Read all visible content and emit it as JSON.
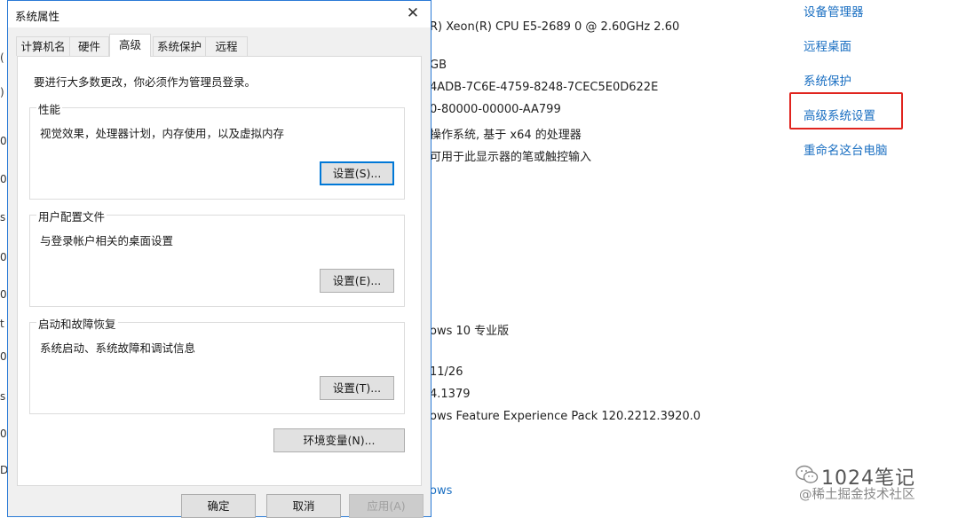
{
  "background": {
    "left_marks": [
      "(",
      ")",
      "0",
      "0",
      "s",
      "0",
      "0",
      "t",
      "0",
      "s",
      "0",
      "D"
    ],
    "info_lines": [
      "R) Xeon(R) CPU E5-2689 0 @ 2.60GHz   2.60",
      "GB",
      "4ADB-7C6E-4759-8248-7CEC5E0D622E",
      "0-80000-00000-AA799",
      "操作系统, 基于 x64 的处理器",
      "可用于此显示器的笔或触控输入",
      "ows 10 专业版",
      "11/26",
      "4.1379",
      "ows Feature Experience Pack 120.2212.3920.0"
    ],
    "info_link": "ows",
    "right_links": [
      "设备管理器",
      "远程桌面",
      "系统保护",
      "高级系统设置",
      "重命名这台电脑"
    ],
    "highlight_color": "#e0241e",
    "watermark": {
      "main": "1024笔记",
      "sub": "@稀土掘金技术社区"
    }
  },
  "dialog": {
    "title": "系统属性",
    "close_glyph": "✕",
    "tabs": [
      "计算机名",
      "硬件",
      "高级",
      "系统保护",
      "远程"
    ],
    "active_tab": "高级",
    "notice": "要进行大多数更改，你必须作为管理员登录。",
    "groups": [
      {
        "title": "性能",
        "description": "视觉效果，处理器计划，内存使用，以及虚拟内存",
        "button": "设置(S)..."
      },
      {
        "title": "用户配置文件",
        "description": "与登录帐户相关的桌面设置",
        "button": "设置(E)..."
      },
      {
        "title": "启动和故障恢复",
        "description": "系统启动、系统故障和调试信息",
        "button": "设置(T)..."
      }
    ],
    "env_button": "环境变量(N)...",
    "footer": {
      "ok": "确定",
      "cancel": "取消",
      "apply": "应用(A)"
    }
  }
}
